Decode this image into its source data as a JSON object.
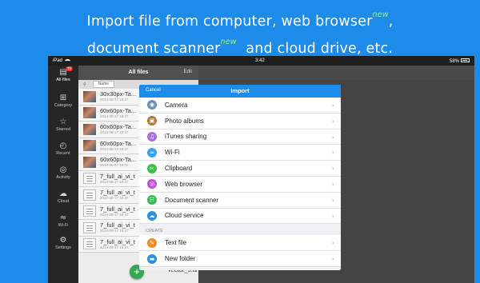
{
  "headline": {
    "line1_pre": "Import file from computer, web browser",
    "line1_sup": "new",
    "line1_post": ",",
    "line2_pre": "document scanner",
    "line2_sup": "new",
    "line2_post": "  and cloud drive, etc."
  },
  "statusbar": {
    "carrier": "iPad",
    "time": "3:42",
    "battery": "58%"
  },
  "sidebar": {
    "items": [
      {
        "label": "All files",
        "icon": "all-files-icon",
        "glyph": "▤",
        "badge": "70"
      },
      {
        "label": "Category",
        "icon": "category-icon",
        "glyph": "⊞"
      },
      {
        "label": "Starred",
        "icon": "star-icon",
        "glyph": "☆"
      },
      {
        "label": "Recent",
        "icon": "clock-icon",
        "glyph": "◴"
      },
      {
        "label": "Activity",
        "icon": "activity-icon",
        "glyph": "◎"
      },
      {
        "label": "Cloud",
        "icon": "cloud-icon",
        "glyph": "☁"
      },
      {
        "label": "Wi-Fi",
        "icon": "wifi-icon",
        "glyph": "≈"
      },
      {
        "label": "Settings",
        "icon": "gear-icon",
        "glyph": "⚙"
      }
    ]
  },
  "list": {
    "title": "All files",
    "edit_label": "Edit",
    "sort_label": "Name",
    "files": [
      {
        "name": "30x30px-Ta...",
        "date": "2014-08-17 19:37",
        "kind": "image"
      },
      {
        "name": "60x60px-Ta...",
        "date": "2014-08-17 19:37",
        "kind": "image"
      },
      {
        "name": "60x60px-Ta...",
        "date": "2014-08-17 19:37",
        "kind": "image"
      },
      {
        "name": "60x60px-Ta...",
        "date": "2014-08-17 19:37",
        "kind": "image"
      },
      {
        "name": "60x60px-Ta...",
        "date": "2014-08-17 19:37",
        "kind": "image"
      },
      {
        "name": "7_full_ai_vi_t",
        "date": "2014-08-17 19:37",
        "kind": "doc"
      },
      {
        "name": "7_full_ai_vi_t",
        "date": "2014-08-17 19:37",
        "kind": "doc"
      },
      {
        "name": "7_full_ai_vi_t",
        "date": "2014-08-17 19:37",
        "kind": "doc"
      },
      {
        "name": "7_full_ai_vi_t",
        "date": "2014-08-17 19:37",
        "kind": "doc"
      },
      {
        "name": "7_full_ai_vi_t",
        "date": "2014-08-17 19:37",
        "kind": "doc"
      }
    ],
    "bottom_file": "vector_5.ai"
  },
  "fab": {
    "label": "+"
  },
  "import_modal": {
    "cancel_label": "Cancel",
    "title": "Import",
    "chevron": "›",
    "items": [
      {
        "label": "Camera",
        "icon": "camera-icon",
        "color": "#6b8fb5",
        "glyph": "◉"
      },
      {
        "label": "Photo albums",
        "icon": "photo-albums-icon",
        "color": "#b07a3a",
        "glyph": "▣"
      },
      {
        "label": "iTunes sharing",
        "icon": "itunes-icon",
        "color": "#a86fd6",
        "glyph": "♫"
      },
      {
        "label": "Wi-Fi",
        "icon": "wifi-icon",
        "color": "#3aa0f0",
        "glyph": "≈"
      },
      {
        "label": "Clipboard",
        "icon": "clipboard-icon",
        "color": "#3fbf4a",
        "glyph": "✂"
      },
      {
        "label": "Web browser",
        "icon": "web-browser-icon",
        "color": "#c24fd9",
        "glyph": "◎"
      },
      {
        "label": "Document scanner",
        "icon": "scanner-icon",
        "color": "#39b85a",
        "glyph": "☷"
      },
      {
        "label": "Cloud service",
        "icon": "cloud-icon",
        "color": "#2f8fe0",
        "glyph": "☁"
      }
    ],
    "create_section": "CREATE",
    "create_items": [
      {
        "label": "Text file",
        "icon": "text-file-icon",
        "color": "#f08a24",
        "glyph": "✎"
      },
      {
        "label": "New folder",
        "icon": "folder-icon",
        "color": "#2f8fe0",
        "glyph": "▬"
      }
    ]
  },
  "colors": {
    "background": "#1d8be9",
    "new_tag": "#9ff08f",
    "modal_header": "#1d8be9",
    "fab": "#34a853"
  }
}
